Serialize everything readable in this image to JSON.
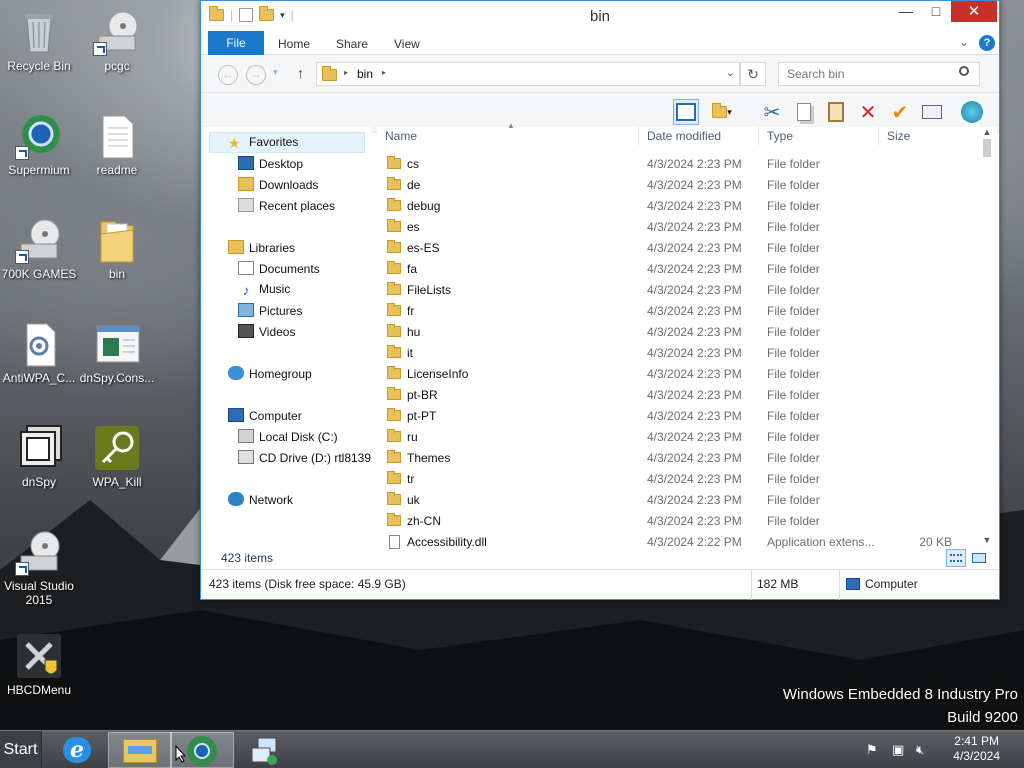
{
  "desktop": {
    "icons": [
      {
        "label": "Recycle Bin",
        "name": "recycle-bin"
      },
      {
        "label": "pcgc",
        "name": "pcgc"
      },
      {
        "label": "Supermium",
        "name": "supermium"
      },
      {
        "label": "readme",
        "name": "readme"
      },
      {
        "label": "700K GAMES",
        "name": "700k-games"
      },
      {
        "label": "bin",
        "name": "bin"
      },
      {
        "label": "AntiWPA_C...",
        "name": "antiwpa"
      },
      {
        "label": "dnSpy.Cons...",
        "name": "dnspy-console"
      },
      {
        "label": "dnSpy",
        "name": "dnspy"
      },
      {
        "label": "WPA_Kill",
        "name": "wpa-kill"
      },
      {
        "label": "Visual Studio 2015",
        "name": "visual-studio-2015"
      },
      {
        "label": "HBCDMenu",
        "name": "hbcdmenu"
      }
    ],
    "watermark_line1": "Windows Embedded 8 Industry Pro",
    "watermark_line2": "Build 9200"
  },
  "window": {
    "title": "bin",
    "minimize": "—",
    "maximize": "□",
    "close": "✕",
    "ribbon_tabs": {
      "file": "File",
      "home": "Home",
      "share": "Share",
      "view": "View"
    },
    "address": {
      "back": "←",
      "forward": "→",
      "up": "↑",
      "path": "bin",
      "refresh": "↻"
    },
    "search": {
      "placeholder": "Search bin"
    },
    "nav": {
      "favorites": "Favorites",
      "desktop": "Desktop",
      "downloads": "Downloads",
      "recent": "Recent places",
      "libraries": "Libraries",
      "documents": "Documents",
      "music": "Music",
      "pictures": "Pictures",
      "videos": "Videos",
      "homegroup": "Homegroup",
      "computer": "Computer",
      "local_disk": "Local Disk (C:)",
      "cd_drive": "CD Drive (D:) rtl8139",
      "network": "Network"
    },
    "columns": {
      "name": "Name",
      "date": "Date modified",
      "type": "Type",
      "size": "Size"
    },
    "files": [
      {
        "name": "cs",
        "date": "4/3/2024 2:23 PM",
        "type": "File folder",
        "size": ""
      },
      {
        "name": "de",
        "date": "4/3/2024 2:23 PM",
        "type": "File folder",
        "size": ""
      },
      {
        "name": "debug",
        "date": "4/3/2024 2:23 PM",
        "type": "File folder",
        "size": ""
      },
      {
        "name": "es",
        "date": "4/3/2024 2:23 PM",
        "type": "File folder",
        "size": ""
      },
      {
        "name": "es-ES",
        "date": "4/3/2024 2:23 PM",
        "type": "File folder",
        "size": ""
      },
      {
        "name": "fa",
        "date": "4/3/2024 2:23 PM",
        "type": "File folder",
        "size": ""
      },
      {
        "name": "FileLists",
        "date": "4/3/2024 2:23 PM",
        "type": "File folder",
        "size": ""
      },
      {
        "name": "fr",
        "date": "4/3/2024 2:23 PM",
        "type": "File folder",
        "size": ""
      },
      {
        "name": "hu",
        "date": "4/3/2024 2:23 PM",
        "type": "File folder",
        "size": ""
      },
      {
        "name": "it",
        "date": "4/3/2024 2:23 PM",
        "type": "File folder",
        "size": ""
      },
      {
        "name": "LicenseInfo",
        "date": "4/3/2024 2:23 PM",
        "type": "File folder",
        "size": ""
      },
      {
        "name": "pt-BR",
        "date": "4/3/2024 2:23 PM",
        "type": "File folder",
        "size": ""
      },
      {
        "name": "pt-PT",
        "date": "4/3/2024 2:23 PM",
        "type": "File folder",
        "size": ""
      },
      {
        "name": "ru",
        "date": "4/3/2024 2:23 PM",
        "type": "File folder",
        "size": ""
      },
      {
        "name": "Themes",
        "date": "4/3/2024 2:23 PM",
        "type": "File folder",
        "size": ""
      },
      {
        "name": "tr",
        "date": "4/3/2024 2:23 PM",
        "type": "File folder",
        "size": ""
      },
      {
        "name": "uk",
        "date": "4/3/2024 2:23 PM",
        "type": "File folder",
        "size": ""
      },
      {
        "name": "zh-CN",
        "date": "4/3/2024 2:23 PM",
        "type": "File folder",
        "size": ""
      },
      {
        "name": "Accessibility.dll",
        "date": "4/3/2024 2:22 PM",
        "type": "Application extens...",
        "size": "20 KB"
      }
    ],
    "item_count": "423 items",
    "status": {
      "left": "423 items (Disk free space: 45.9 GB)",
      "mid": "182 MB",
      "right": "Computer"
    }
  },
  "taskbar": {
    "start": "Start",
    "clock_time": "2:41 PM",
    "clock_date": "4/3/2024"
  }
}
